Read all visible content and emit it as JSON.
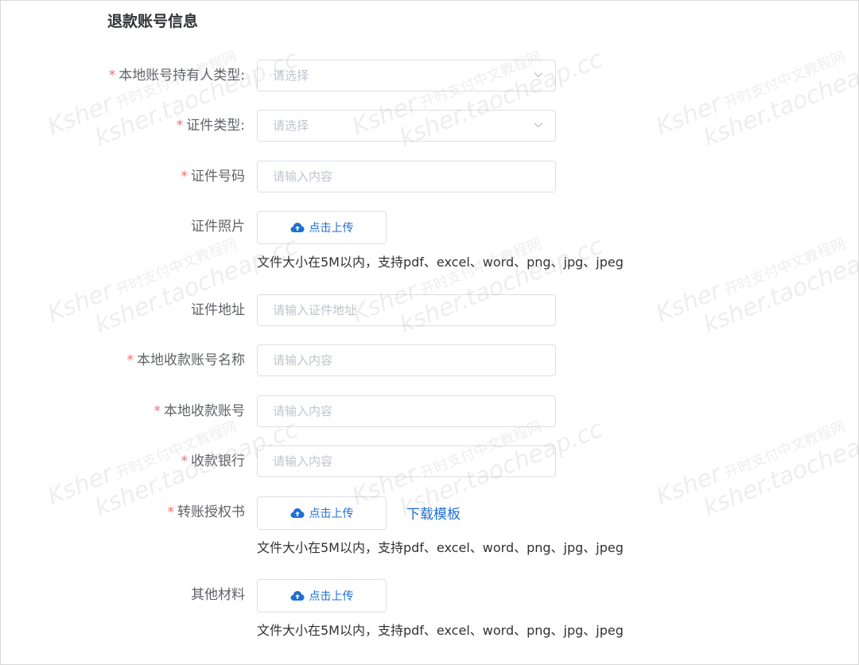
{
  "section_title": "退款账号信息",
  "rows": {
    "holder_type": {
      "label": "本地账号持有人类型:",
      "required": "*",
      "placeholder": "请选择"
    },
    "id_type": {
      "label": "证件类型:",
      "required": "*",
      "placeholder": "请选择"
    },
    "id_number": {
      "label": "证件号码",
      "required": "*",
      "placeholder": "请输入内容"
    },
    "id_photo": {
      "label": "证件照片",
      "upload_label": "点击上传",
      "hint": "文件大小在5M以内，支持pdf、excel、word、png、jpg、jpeg"
    },
    "id_address": {
      "label": "证件地址",
      "placeholder": "请输入证件地址"
    },
    "account_name": {
      "label": "本地收款账号名称",
      "required": "*",
      "placeholder": "请输入内容"
    },
    "account_number": {
      "label": "本地收款账号",
      "required": "*",
      "placeholder": "请输入内容"
    },
    "bank": {
      "label": "收款银行",
      "required": "*",
      "placeholder": "请输入内容"
    },
    "transfer_auth": {
      "label": "转账授权书",
      "required": "*",
      "upload_label": "点击上传",
      "download_link": "下载模板",
      "hint": "文件大小在5M以内，支持pdf、excel、word、png、jpg、jpeg"
    },
    "other_materials": {
      "label": "其他材料",
      "upload_label": "点击上传",
      "hint": "文件大小在5M以内，支持pdf、excel、word、png、jpg、jpeg"
    }
  },
  "watermark": {
    "brand": "Ksher",
    "cn_text": "开时支付中文教程网",
    "site": "ksher.taocheap.cc"
  },
  "colors": {
    "required": "#f56c6c",
    "link": "#1f6fd1",
    "border": "#dcdfe6",
    "placeholder": "#c0c4cc"
  }
}
